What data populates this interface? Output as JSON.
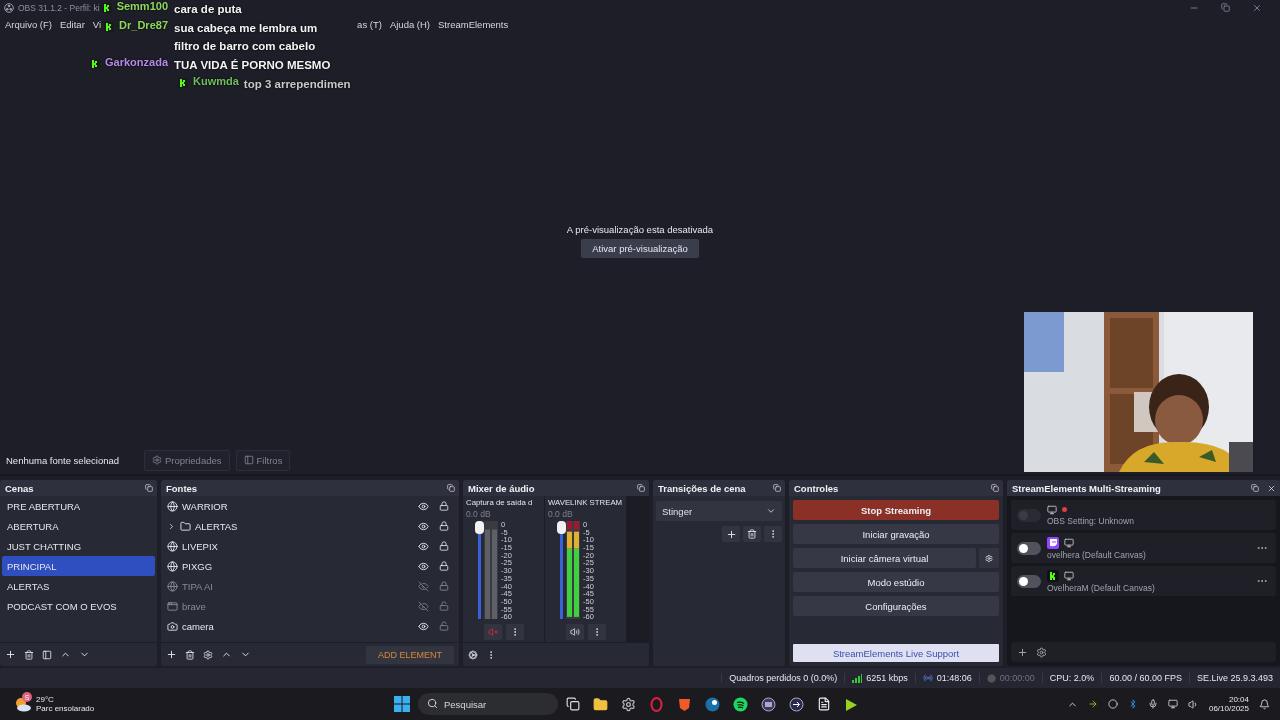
{
  "window": {
    "title": "OBS 31.1.2 - Perfil: ki"
  },
  "menu": [
    {
      "label": "Arquivo (F)"
    },
    {
      "label": "Editar"
    },
    {
      "label": "Vi"
    },
    {
      "label": "as (T)"
    },
    {
      "label": "Ajuda (H)"
    },
    {
      "label": "StreamElements"
    }
  ],
  "chat_overlay": [
    {
      "user": "Semm100",
      "message": "cara de puta",
      "color": "#8fd85a"
    },
    {
      "user": "Dr_Dre87",
      "message": "sua cabeça me lembra um filtro de barro com cabelo",
      "color": "#8fd85a"
    },
    {
      "user": "Garkonzada",
      "message": "TUA VIDA É PORNO MESMO",
      "color": "#b48be8"
    },
    {
      "user": "Kuwmda",
      "message": "top 3 arrependimen",
      "color": "#6fbf5f"
    }
  ],
  "preview": {
    "message": "A pré-visualização esta desativada",
    "button": "Ativar pré-visualização"
  },
  "source_toolbar": {
    "label": "Nenhuma fonte selecionad",
    "buttons": [
      {
        "label": "Propriedades",
        "kind": "properties",
        "disabled": true
      },
      {
        "label": "Filtros",
        "kind": "filters",
        "disabled": true
      }
    ]
  },
  "scenes": {
    "title": "Cenas",
    "items": [
      {
        "name": "PRE ABERTURA",
        "selected": false
      },
      {
        "name": "ABERTURA",
        "selected": false
      },
      {
        "name": "JUST CHATTING",
        "selected": false
      },
      {
        "name": "PRINCIPAL",
        "selected": true
      },
      {
        "name": "ALERTAS",
        "selected": false
      },
      {
        "name": "PODCAST COM O EVOS",
        "selected": false
      }
    ]
  },
  "sources": {
    "title": "Fontes",
    "items": [
      {
        "name": "WARRIOR",
        "kind": "browser",
        "visible": true,
        "locked": true
      },
      {
        "name": "ALERTAS",
        "kind": "folder",
        "visible": true,
        "locked": true,
        "expanded": false
      },
      {
        "name": "LIVEPIX",
        "kind": "browser",
        "visible": true,
        "locked": true
      },
      {
        "name": "PIXGG",
        "kind": "browser",
        "visible": true,
        "locked": true
      },
      {
        "name": "TIPA AI",
        "kind": "browser",
        "visible": false,
        "locked": true
      },
      {
        "name": "brave",
        "kind": "window",
        "visible": false,
        "locked": false
      },
      {
        "name": "camera",
        "kind": "camera",
        "visible": true,
        "locked": false
      }
    ],
    "add_button": "ADD ELEMENT"
  },
  "mixer": {
    "title": "Mixer de áudio",
    "channels": [
      {
        "name": "Captura de saída d",
        "reading": "0.0 dB",
        "level": 1,
        "muted": true,
        "scale": [
          "0",
          "-5",
          "-10",
          "-15",
          "-20",
          "-25",
          "-30",
          "-35",
          "-40",
          "-45",
          "-50",
          "-55",
          "-60"
        ]
      },
      {
        "name": "WAVELINK STREAM",
        "reading": "0.0 dB",
        "level": 1,
        "muted": false,
        "scale": [
          "0",
          "-5",
          "-10",
          "-15",
          "-20",
          "-25",
          "-30",
          "-35",
          "-40",
          "-45",
          "-50",
          "-55",
          "-60"
        ]
      }
    ]
  },
  "transitions": {
    "title": "Transições de cena",
    "value": "Stinger"
  },
  "controls": {
    "title": "Controles",
    "buttons": [
      {
        "label": "Stop Streaming",
        "kind": "live"
      },
      {
        "label": "Iniciar gravação",
        "kind": "plain"
      },
      {
        "label": "Iniciar câmera virtual",
        "kind": "with-settings"
      },
      {
        "label": "Modo estúdio",
        "kind": "plain"
      },
      {
        "label": "Configurações",
        "kind": "plain"
      }
    ],
    "support": "StreamElements Live Support"
  },
  "multistream": {
    "title": "StreamElements Multi-Streaming",
    "targets": [
      {
        "name": "OBS Setting: Unknown",
        "kind": "obs",
        "on": false,
        "disabled": true
      },
      {
        "name": "ovelhera (Default Canvas)",
        "kind": "twitch",
        "on": false,
        "disabled": false
      },
      {
        "name": "OvelheraM (Default Canvas)",
        "kind": "kick",
        "on": false,
        "disabled": false
      }
    ]
  },
  "status_bar": {
    "dropped": "Quadros perdidos 0 (0.0%)",
    "bitrate": "6251 kbps",
    "stream_time": "01:48:06",
    "record_time": "00:00:00",
    "cpu": "CPU: 2.0%",
    "fps": "60.00 / 60.00 FPS",
    "plugin": "SE.Live 25.9.3.493"
  },
  "taskbar": {
    "weather_badge": "S",
    "temperature": "29°C",
    "weather": "Parc ensolarado",
    "search": {
      "placeholder": "Pesquisar"
    },
    "time": "20:04",
    "date": "06/10/2025"
  }
}
